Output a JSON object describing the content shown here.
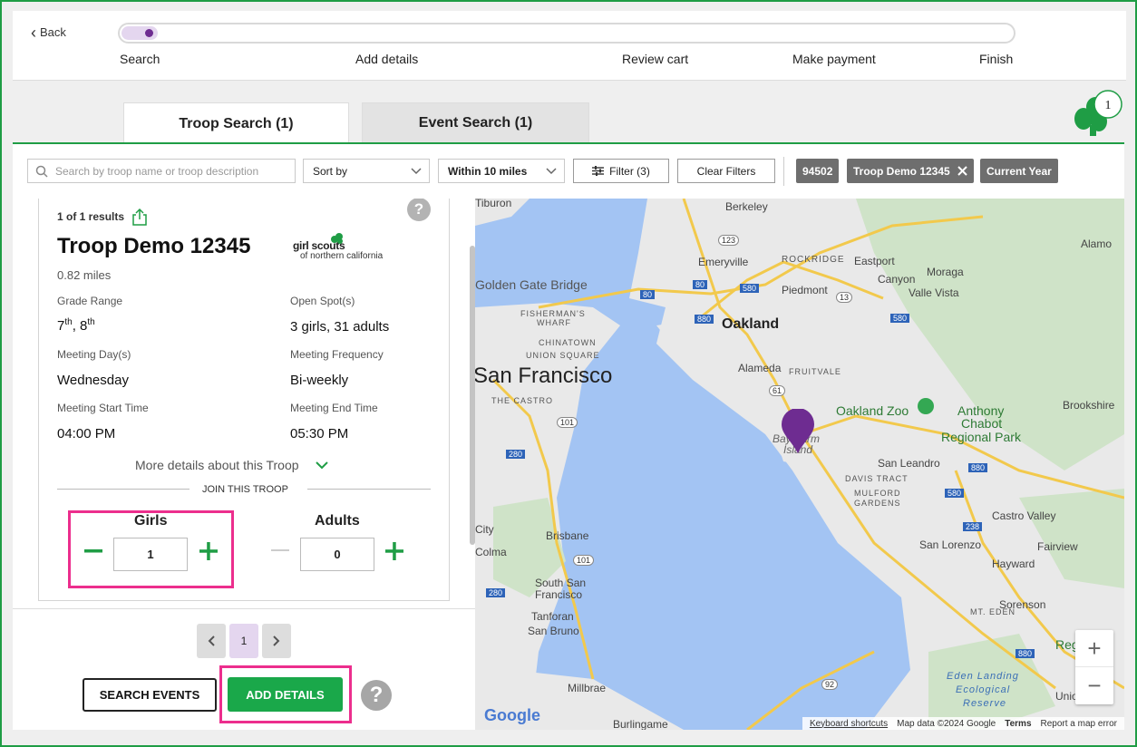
{
  "nav": {
    "back_label": "Back"
  },
  "progress": {
    "current_step": 1,
    "total_steps": 5,
    "steps": [
      "Search",
      "Add details",
      "Review cart",
      "Make payment",
      "Finish"
    ]
  },
  "tabs": [
    {
      "label": "Troop Search (1)",
      "active": true
    },
    {
      "label": "Event Search (1)",
      "active": false
    }
  ],
  "cart": {
    "count": "1",
    "icon": "trefoil-icon",
    "color": "#1f9d45"
  },
  "filters": {
    "search_placeholder": "Search by troop name or troop description",
    "sort_label": "Sort by",
    "distance_label": "Within 10 miles",
    "filter_button": "Filter (3)",
    "clear_button": "Clear Filters",
    "chips": [
      "94502",
      "Troop Demo 12345",
      "Current Year"
    ]
  },
  "result": {
    "count_label": "1 of 1 results",
    "troop_name": "Troop Demo 12345",
    "logo": {
      "line1": "girl scouts",
      "line2": "of northern california"
    },
    "distance": "0.82 miles",
    "grade_label": "Grade Range",
    "grade_value_1": "7",
    "grade_sup_1": "th",
    "grade_sep": ", 8",
    "grade_sup_2": "th",
    "spots_label": "Open Spot(s)",
    "spots_value": "3 girls, 31 adults",
    "days_label": "Meeting Day(s)",
    "days_value": "Wednesday",
    "freq_label": "Meeting Frequency",
    "freq_value": "Bi-weekly",
    "start_label": "Meeting Start Time",
    "start_value": "04:00 PM",
    "end_label": "Meeting End Time",
    "end_value": "05:30 PM",
    "more_details": "More details about this Troop",
    "join_label": "JOIN THIS TROOP",
    "girls_label": "Girls",
    "girls_value": "1",
    "adults_label": "Adults",
    "adults_value": "0"
  },
  "pagination": {
    "current": "1"
  },
  "actions": {
    "search_events": "SEARCH EVENTS",
    "add_details": "ADD DETAILS",
    "help": "?"
  },
  "map": {
    "labels": {
      "tiburon": "Tiburon",
      "berkeley": "Berkeley",
      "alamo": "Alamo",
      "emeryville": "Emeryville",
      "rockridge": "ROCKRIDGE",
      "eastport": "Eastport",
      "moraga": "Moraga",
      "canyon": "Canyon",
      "valle_vista": "Valle Vista",
      "golden_gate": "Golden Gate Bridge",
      "piedmont": "Piedmont",
      "fishermans_wharf_1": "FISHERMAN'S",
      "fishermans_wharf_2": "WHARF",
      "oakland": "Oakland",
      "chinatown": "CHINATOWN",
      "union_square": "UNION SQUARE",
      "alameda": "Alameda",
      "fruitvale": "FRUITVALE",
      "san_francisco": "San Francisco",
      "the_castro": "THE CASTRO",
      "oakland_zoo": "Oakland Zoo",
      "anthony_1": "Anthony",
      "anthony_2": "Chabot",
      "anthony_3": "Regional Park",
      "brookshire": "Brookshire",
      "bay_farm_1": "Bay Farm",
      "bay_farm_2": "Island",
      "san_leandro": "San Leandro",
      "davis_tract": "DAVIS TRACT",
      "mulford_1": "MULFORD",
      "mulford_2": "GARDENS",
      "daly_city": "City",
      "brisbane": "Brisbane",
      "castro_valley": "Castro Valley",
      "colma": "Colma",
      "san_lorenzo": "San Lorenzo",
      "fairview": "Fairview",
      "south_sf_1": "South San",
      "south_sf_2": "Francisco",
      "hayward": "Hayward",
      "tanforan": "Tanforan",
      "san_bruno": "San Bruno",
      "sorenson": "Sorenson",
      "mt_eden": "MT. EDEN",
      "regional": "Regio",
      "millbrae": "Millbrae",
      "eden_1": "Eden Landing",
      "eden_2": "Ecological",
      "eden_3": "Reserve",
      "union": "Union",
      "burlingame": "Burlingame"
    },
    "shields": [
      "123",
      "80",
      "580",
      "13",
      "880",
      "80",
      "580",
      "61",
      "101",
      "280",
      "880",
      "101",
      "580",
      "238",
      "280",
      "92",
      "880"
    ],
    "google": "Google",
    "attribution": {
      "shortcuts": "Keyboard shortcuts",
      "data": "Map data ©2024 Google",
      "terms": "Terms",
      "report": "Report a map error"
    },
    "zoom_in": "+",
    "zoom_out": "−",
    "pin_color": "#6e2c91"
  }
}
